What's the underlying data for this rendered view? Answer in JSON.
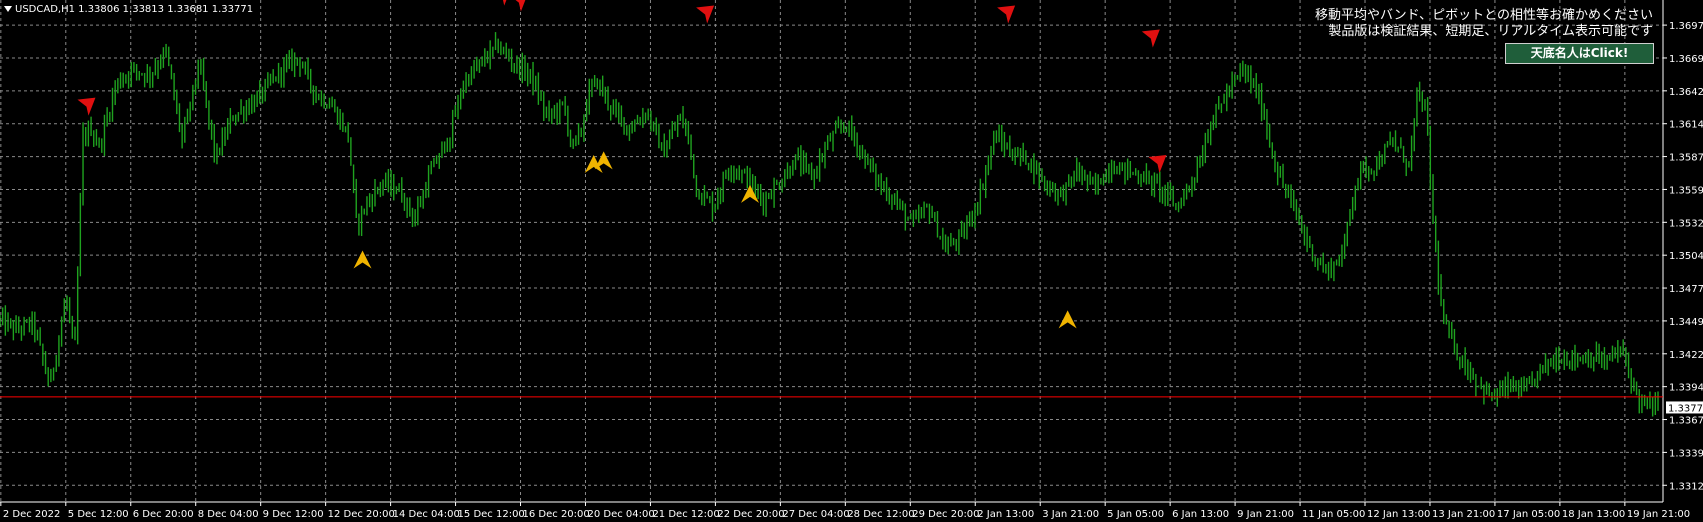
{
  "symbol_info": "USDCAD,H1  1.33806 1.33813 1.33681 1.33771",
  "message_lines": [
    "移動平均やバンド、ピボットとの相性等お確かめください",
    "製品版は検証結果、短期足、リアルタイム表示可能です"
  ],
  "button_label": "天底名人はClick!",
  "colors": {
    "background": "#000000",
    "grid": "#8a8a8a",
    "candles": "#1fa31f",
    "current_line": "#ff0000",
    "sell_arrow": "#e01010",
    "buy_arrow": "#f0b400",
    "axis_text": "#ffffff"
  },
  "chart_data": {
    "type": "candlestick",
    "symbol": "USDCAD",
    "timeframe": "H1",
    "ohlc": {
      "open": "1.33806",
      "high": "1.33813",
      "low": "1.33681",
      "close": "1.33771"
    },
    "current_price": "1.33771",
    "red_line_price": 1.3386,
    "y_ticks": [
      "1.36970",
      "1.36695",
      "1.36420",
      "1.36145",
      "1.35870",
      "1.35595",
      "1.35320",
      "1.35045",
      "1.34770",
      "1.34495",
      "1.34220",
      "1.33945",
      "1.33670",
      "1.33395",
      "1.33120"
    ],
    "x_ticks": [
      "2 Dec 2022",
      "5 Dec 12:00",
      "6 Dec 20:00",
      "8 Dec 04:00",
      "9 Dec 12:00",
      "12 Dec 20:00",
      "14 Dec 04:00",
      "15 Dec 12:00",
      "16 Dec 20:00",
      "20 Dec 04:00",
      "21 Dec 12:00",
      "22 Dec 20:00",
      "27 Dec 04:00",
      "28 Dec 12:00",
      "29 Dec 20:00",
      "2 Jan 13:00",
      "3 Jan 21:00",
      "5 Jan 05:00",
      "6 Jan 13:00",
      "9 Jan 21:00",
      "11 Jan 05:00",
      "12 Jan 13:00",
      "13 Jan 21:00",
      "17 Jan 05:00",
      "18 Jan 13:00",
      "19 Jan 21:00"
    ],
    "ylim": [
      1.3298,
      1.3718
    ],
    "close_path": [
      [
        0,
        1.345
      ],
      [
        0.01,
        1.3442
      ],
      [
        0.02,
        1.3448
      ],
      [
        0.03,
        1.3395
      ],
      [
        0.04,
        1.347
      ],
      [
        0.045,
        1.342
      ],
      [
        0.05,
        1.3603
      ],
      [
        0.055,
        1.361
      ],
      [
        0.06,
        1.3595
      ],
      [
        0.07,
        1.3648
      ],
      [
        0.08,
        1.366
      ],
      [
        0.09,
        1.3655
      ],
      [
        0.1,
        1.3675
      ],
      [
        0.11,
        1.36
      ],
      [
        0.12,
        1.3665
      ],
      [
        0.13,
        1.3585
      ],
      [
        0.14,
        1.362
      ],
      [
        0.155,
        1.3635
      ],
      [
        0.17,
        1.366
      ],
      [
        0.18,
        1.367
      ],
      [
        0.19,
        1.364
      ],
      [
        0.2,
        1.363
      ],
      [
        0.21,
        1.3605
      ],
      [
        0.215,
        1.353
      ],
      [
        0.22,
        1.3545
      ],
      [
        0.23,
        1.3565
      ],
      [
        0.24,
        1.356
      ],
      [
        0.25,
        1.3535
      ],
      [
        0.26,
        1.3575
      ],
      [
        0.27,
        1.36
      ],
      [
        0.28,
        1.365
      ],
      [
        0.29,
        1.3665
      ],
      [
        0.3,
        1.368
      ],
      [
        0.31,
        1.3665
      ],
      [
        0.32,
        1.3655
      ],
      [
        0.33,
        1.362
      ],
      [
        0.34,
        1.363
      ],
      [
        0.345,
        1.3595
      ],
      [
        0.35,
        1.3605
      ],
      [
        0.355,
        1.364
      ],
      [
        0.36,
        1.365
      ],
      [
        0.37,
        1.3625
      ],
      [
        0.38,
        1.361
      ],
      [
        0.39,
        1.3625
      ],
      [
        0.4,
        1.359
      ],
      [
        0.41,
        1.362
      ],
      [
        0.415,
        1.3605
      ],
      [
        0.42,
        1.356
      ],
      [
        0.43,
        1.3545
      ],
      [
        0.44,
        1.358
      ],
      [
        0.45,
        1.357
      ],
      [
        0.46,
        1.355
      ],
      [
        0.47,
        1.3565
      ],
      [
        0.48,
        1.3585
      ],
      [
        0.49,
        1.357
      ],
      [
        0.5,
        1.36
      ],
      [
        0.51,
        1.3615
      ],
      [
        0.52,
        1.359
      ],
      [
        0.53,
        1.3565
      ],
      [
        0.54,
        1.355
      ],
      [
        0.55,
        1.353
      ],
      [
        0.56,
        1.3545
      ],
      [
        0.57,
        1.351
      ],
      [
        0.58,
        1.352
      ],
      [
        0.59,
        1.355
      ],
      [
        0.6,
        1.3605
      ],
      [
        0.61,
        1.359
      ],
      [
        0.62,
        1.3585
      ],
      [
        0.63,
        1.3565
      ],
      [
        0.64,
        1.3555
      ],
      [
        0.65,
        1.3575
      ],
      [
        0.66,
        1.356
      ],
      [
        0.67,
        1.358
      ],
      [
        0.68,
        1.3575
      ],
      [
        0.69,
        1.357
      ],
      [
        0.7,
        1.356
      ],
      [
        0.71,
        1.3545
      ],
      [
        0.72,
        1.357
      ],
      [
        0.725,
        1.359
      ],
      [
        0.73,
        1.3615
      ],
      [
        0.74,
        1.364
      ],
      [
        0.75,
        1.366
      ],
      [
        0.76,
        1.3635
      ],
      [
        0.77,
        1.3575
      ],
      [
        0.78,
        1.3545
      ],
      [
        0.79,
        1.351
      ],
      [
        0.8,
        1.349
      ],
      [
        0.81,
        1.3505
      ],
      [
        0.815,
        1.355
      ],
      [
        0.82,
        1.3575
      ],
      [
        0.83,
        1.358
      ],
      [
        0.84,
        1.36
      ],
      [
        0.85,
        1.358
      ],
      [
        0.855,
        1.364
      ],
      [
        0.86,
        1.3625
      ],
      [
        0.865,
        1.352
      ],
      [
        0.87,
        1.345
      ],
      [
        0.88,
        1.342
      ],
      [
        0.89,
        1.34
      ],
      [
        0.9,
        1.3385
      ],
      [
        0.91,
        1.3395
      ],
      [
        0.92,
        1.339
      ],
      [
        0.93,
        1.341
      ],
      [
        0.94,
        1.342
      ],
      [
        0.95,
        1.3418
      ],
      [
        0.96,
        1.342
      ],
      [
        0.97,
        1.3415
      ],
      [
        0.975,
        1.3425
      ],
      [
        0.98,
        1.342
      ],
      [
        0.985,
        1.3395
      ],
      [
        0.99,
        1.338
      ],
      [
        1.0,
        1.3377
      ]
    ],
    "signals": [
      {
        "type": "sell",
        "x": 0.052,
        "price": 1.3628
      },
      {
        "type": "sell",
        "x": 0.302,
        "price": 1.372
      },
      {
        "type": "sell",
        "x": 0.312,
        "price": 1.3715
      },
      {
        "type": "sell",
        "x": 0.424,
        "price": 1.3705
      },
      {
        "type": "sell",
        "x": 0.605,
        "price": 1.3705
      },
      {
        "type": "sell",
        "x": 0.692,
        "price": 1.3685
      },
      {
        "type": "sell",
        "x": 0.696,
        "price": 1.358
      },
      {
        "type": "buy",
        "x": 0.218,
        "price": 1.35
      },
      {
        "type": "buy",
        "x": 0.357,
        "price": 1.358
      },
      {
        "type": "buy",
        "x": 0.363,
        "price": 1.3583
      },
      {
        "type": "buy",
        "x": 0.451,
        "price": 1.3555
      },
      {
        "type": "buy",
        "x": 0.642,
        "price": 1.345
      }
    ]
  }
}
